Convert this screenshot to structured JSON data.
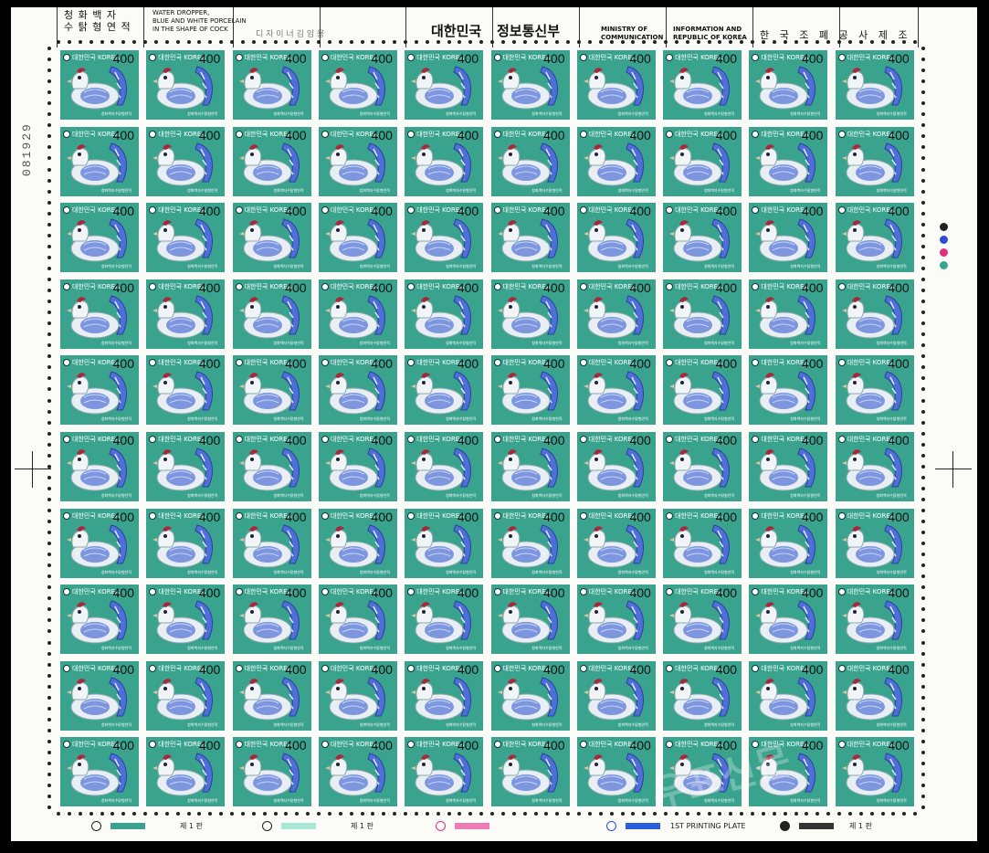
{
  "header": {
    "korean_title_line1": "청 화 백 자",
    "korean_title_line2": "수 탉 형 연 적",
    "english_title": [
      "WATER DROPPER,",
      "BLUE AND WHITE PORCELAIN",
      "IN THE SHAPE OF COCK"
    ],
    "designer": "디 자 이 너  김 임 용",
    "country_korean": "대한민국",
    "ministry_korean": "정보통신부",
    "ministry_english": [
      "MINISTRY OF",
      "COMMUNICATION"
    ],
    "info_english": [
      "INFORMATION AND",
      "REPUBLIC OF KOREA"
    ],
    "printer_korean": "한 국 조 폐 공 사 제 조"
  },
  "stamp": {
    "country": "대한민국 KOREA",
    "value": "400",
    "caption": "청화백자수탉형연적",
    "background_color": "#3aa38e",
    "rows": 10,
    "cols": 10
  },
  "serial_number": "081929",
  "color_dots": [
    "#222222",
    "#2a4fd0",
    "#e0307a",
    "#3aa38e"
  ],
  "footer": {
    "plate_label_1": "제 1 판",
    "plate_label_2": "제 1 판",
    "plate_label_3": "1ST PRINTING PLATE",
    "plate_label_4": "제 1 판",
    "bars": [
      "#3aa38e",
      "#a8e6d6",
      "#f07ab4",
      "#2a5fe0",
      "#333333"
    ]
  },
  "watermark": "우표신문"
}
